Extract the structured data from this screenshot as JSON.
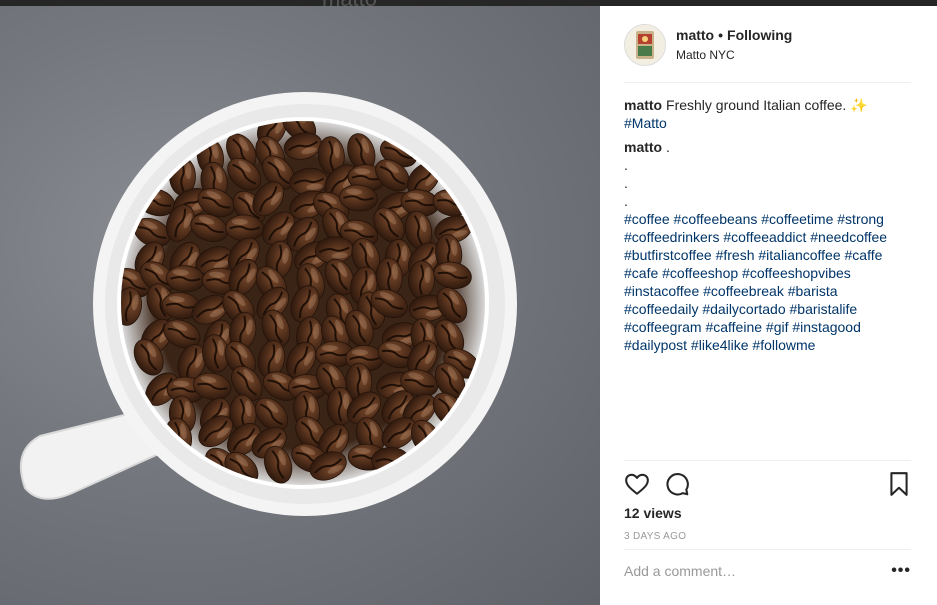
{
  "background_header": {
    "ghost_text": "matto"
  },
  "post": {
    "image": {
      "description_icon": "coffee-cup-with-beans"
    },
    "author": {
      "username": "matto",
      "separator": "•",
      "follow_status": "Following",
      "location": "Matto NYC"
    },
    "caption": {
      "username": "matto",
      "text": "Freshly ground Italian coffee.",
      "emoji": "✨",
      "tag": "#Matto"
    },
    "comment": {
      "username": "matto",
      "first": ".",
      "dots": [
        ".",
        ".",
        "."
      ],
      "hashtags": [
        "#coffee #coffeebeans #coffeetime #strong",
        "#coffeedrinkers #coffeeaddict #needcoffee",
        "#butfirstcoffee #fresh #italiancoffee #caffe",
        "#cafe #coffeeshop #coffeeshopvibes",
        "#instacoffee #coffeebreak #barista",
        "#coffeedaily #dailycortado #baristalife",
        "#coffeegram #caffeine #gif #instagood",
        "#dailypost #like4like #followme"
      ]
    },
    "stats": {
      "views": "12 views",
      "date": "3 DAYS AGO"
    },
    "comment_box": {
      "placeholder": "Add a comment…",
      "more_label": "•••"
    },
    "colors": {
      "link": "#003569",
      "text": "#262626",
      "muted": "#999999",
      "divider": "#efefef"
    }
  }
}
